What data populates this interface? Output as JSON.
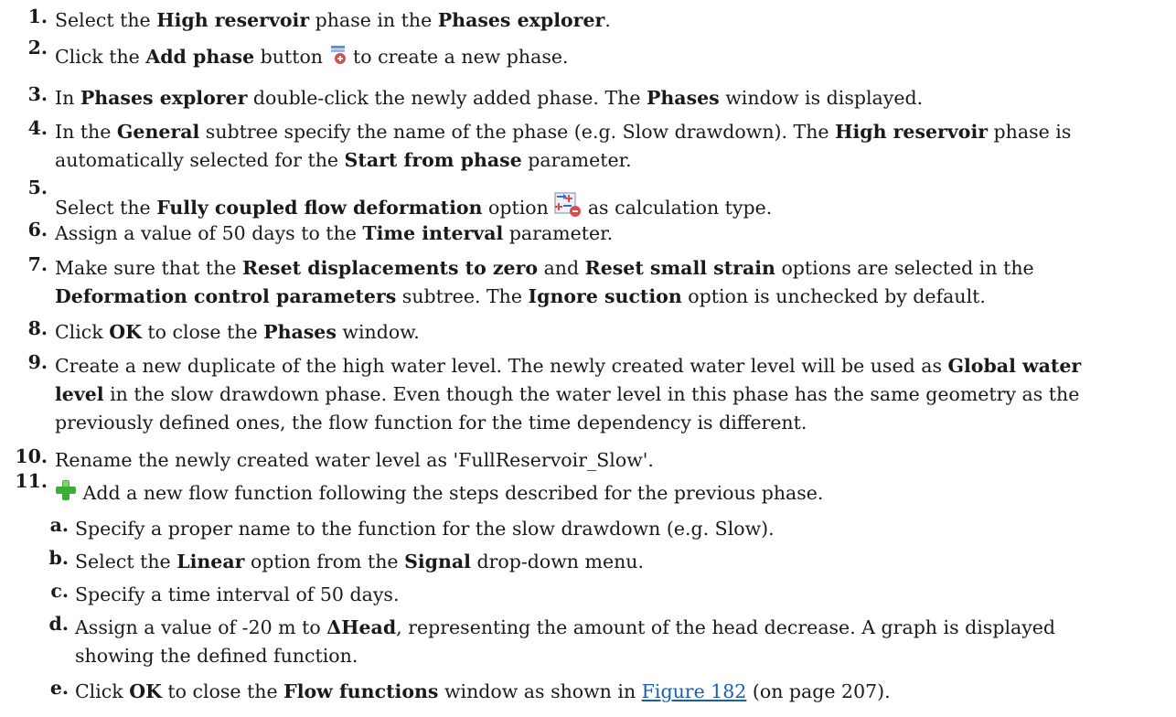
{
  "steps": [
    {
      "num": "1.",
      "parts": [
        "Select the ",
        "High reservoir",
        " phase in the ",
        "Phases explorer",
        "."
      ]
    },
    {
      "num": "2.",
      "parts": [
        "Click the ",
        "Add phase",
        " button ",
        " to create a new phase."
      ],
      "icon": "add-phase-icon"
    },
    {
      "num": "3.",
      "parts": [
        "In ",
        "Phases explorer",
        " double-click the newly added phase. The ",
        "Phases",
        " window is displayed."
      ]
    },
    {
      "num": "4.",
      "lines": [
        [
          "In the ",
          "General",
          " subtree specify the name of the phase (e.g. Slow drawdown). The ",
          "High reservoir",
          " phase is"
        ],
        [
          "automatically selected for the ",
          "Start from phase",
          " parameter."
        ]
      ]
    },
    {
      "num": "5.",
      "parts": [
        "Select the ",
        "Fully coupled flow deformation",
        " option ",
        " as calculation type."
      ],
      "icon": "fully-coupled-flow-deformation-icon"
    },
    {
      "num": "6.",
      "parts": [
        "Assign a value of 50 days to the ",
        "Time interval",
        " parameter."
      ]
    },
    {
      "num": "7.",
      "lines": [
        [
          "Make sure that the ",
          "Reset displacements to zero",
          " and ",
          "Reset small strain",
          " options are selected in the"
        ],
        [
          "",
          "Deformation control parameters",
          " subtree. The ",
          "Ignore suction",
          " option is unchecked by default."
        ]
      ]
    },
    {
      "num": "8.",
      "parts": [
        "Click ",
        "OK",
        " to close the ",
        "Phases",
        " window."
      ]
    },
    {
      "num": "9.",
      "lines": [
        [
          "Create a new duplicate of the high water level. The newly created water level will be used as ",
          "Global water"
        ],
        [
          "",
          "level",
          " in the slow drawdown phase. Even though the water level in this phase has the same geometry as the"
        ],
        [
          "previously defined ones, the flow function for the time dependency is different."
        ]
      ]
    },
    {
      "num": "10.",
      "parts": [
        "Rename the newly created water level as 'FullReservoir_Slow'."
      ]
    },
    {
      "num": "11.",
      "parts": [
        " Add a new flow function following the steps described for the previous phase."
      ],
      "icon": "add-green-plus-icon"
    }
  ],
  "substeps": [
    {
      "num": "a.",
      "parts": [
        "Specify a proper name to the function for the slow drawdown (e.g. Slow)."
      ]
    },
    {
      "num": "b.",
      "parts": [
        "Select the ",
        "Linear",
        " option from the ",
        "Signal",
        " drop-down menu."
      ]
    },
    {
      "num": "c.",
      "parts": [
        "Specify a time interval of 50 days."
      ]
    },
    {
      "num": "d.",
      "lines": [
        [
          "Assign a value of -20 m to ",
          "ΔHead",
          ", representing the amount of the head decrease. A graph is displayed"
        ],
        [
          "showing the defined function."
        ]
      ]
    },
    {
      "num": "e.",
      "parts": [
        "Click ",
        "OK",
        " to close the ",
        "Flow functions",
        " window as shown in ",
        "Figure 182",
        " (on page 207)."
      ]
    }
  ],
  "colors": {
    "link": "#1a5fb4",
    "text": "#1a1a1a",
    "plus_green": "#3cb034"
  }
}
